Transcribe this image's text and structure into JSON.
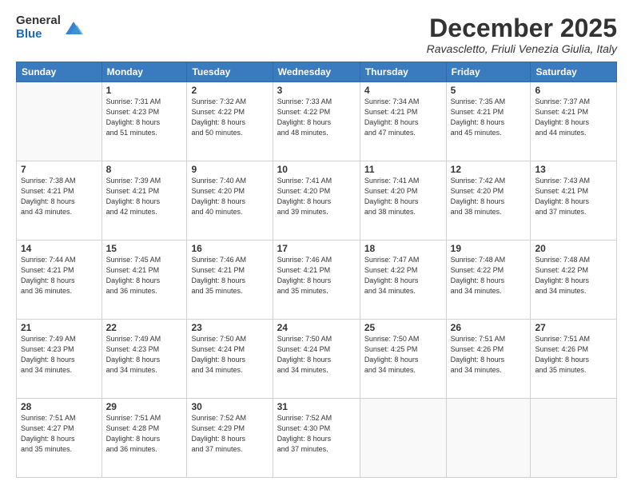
{
  "logo": {
    "general": "General",
    "blue": "Blue"
  },
  "header": {
    "month": "December 2025",
    "location": "Ravascletto, Friuli Venezia Giulia, Italy"
  },
  "weekdays": [
    "Sunday",
    "Monday",
    "Tuesday",
    "Wednesday",
    "Thursday",
    "Friday",
    "Saturday"
  ],
  "weeks": [
    [
      {
        "day": "",
        "info": ""
      },
      {
        "day": "1",
        "info": "Sunrise: 7:31 AM\nSunset: 4:23 PM\nDaylight: 8 hours\nand 51 minutes."
      },
      {
        "day": "2",
        "info": "Sunrise: 7:32 AM\nSunset: 4:22 PM\nDaylight: 8 hours\nand 50 minutes."
      },
      {
        "day": "3",
        "info": "Sunrise: 7:33 AM\nSunset: 4:22 PM\nDaylight: 8 hours\nand 48 minutes."
      },
      {
        "day": "4",
        "info": "Sunrise: 7:34 AM\nSunset: 4:21 PM\nDaylight: 8 hours\nand 47 minutes."
      },
      {
        "day": "5",
        "info": "Sunrise: 7:35 AM\nSunset: 4:21 PM\nDaylight: 8 hours\nand 45 minutes."
      },
      {
        "day": "6",
        "info": "Sunrise: 7:37 AM\nSunset: 4:21 PM\nDaylight: 8 hours\nand 44 minutes."
      }
    ],
    [
      {
        "day": "7",
        "info": "Sunrise: 7:38 AM\nSunset: 4:21 PM\nDaylight: 8 hours\nand 43 minutes."
      },
      {
        "day": "8",
        "info": "Sunrise: 7:39 AM\nSunset: 4:21 PM\nDaylight: 8 hours\nand 42 minutes."
      },
      {
        "day": "9",
        "info": "Sunrise: 7:40 AM\nSunset: 4:20 PM\nDaylight: 8 hours\nand 40 minutes."
      },
      {
        "day": "10",
        "info": "Sunrise: 7:41 AM\nSunset: 4:20 PM\nDaylight: 8 hours\nand 39 minutes."
      },
      {
        "day": "11",
        "info": "Sunrise: 7:41 AM\nSunset: 4:20 PM\nDaylight: 8 hours\nand 38 minutes."
      },
      {
        "day": "12",
        "info": "Sunrise: 7:42 AM\nSunset: 4:20 PM\nDaylight: 8 hours\nand 38 minutes."
      },
      {
        "day": "13",
        "info": "Sunrise: 7:43 AM\nSunset: 4:21 PM\nDaylight: 8 hours\nand 37 minutes."
      }
    ],
    [
      {
        "day": "14",
        "info": "Sunrise: 7:44 AM\nSunset: 4:21 PM\nDaylight: 8 hours\nand 36 minutes."
      },
      {
        "day": "15",
        "info": "Sunrise: 7:45 AM\nSunset: 4:21 PM\nDaylight: 8 hours\nand 36 minutes."
      },
      {
        "day": "16",
        "info": "Sunrise: 7:46 AM\nSunset: 4:21 PM\nDaylight: 8 hours\nand 35 minutes."
      },
      {
        "day": "17",
        "info": "Sunrise: 7:46 AM\nSunset: 4:21 PM\nDaylight: 8 hours\nand 35 minutes."
      },
      {
        "day": "18",
        "info": "Sunrise: 7:47 AM\nSunset: 4:22 PM\nDaylight: 8 hours\nand 34 minutes."
      },
      {
        "day": "19",
        "info": "Sunrise: 7:48 AM\nSunset: 4:22 PM\nDaylight: 8 hours\nand 34 minutes."
      },
      {
        "day": "20",
        "info": "Sunrise: 7:48 AM\nSunset: 4:22 PM\nDaylight: 8 hours\nand 34 minutes."
      }
    ],
    [
      {
        "day": "21",
        "info": "Sunrise: 7:49 AM\nSunset: 4:23 PM\nDaylight: 8 hours\nand 34 minutes."
      },
      {
        "day": "22",
        "info": "Sunrise: 7:49 AM\nSunset: 4:23 PM\nDaylight: 8 hours\nand 34 minutes."
      },
      {
        "day": "23",
        "info": "Sunrise: 7:50 AM\nSunset: 4:24 PM\nDaylight: 8 hours\nand 34 minutes."
      },
      {
        "day": "24",
        "info": "Sunrise: 7:50 AM\nSunset: 4:24 PM\nDaylight: 8 hours\nand 34 minutes."
      },
      {
        "day": "25",
        "info": "Sunrise: 7:50 AM\nSunset: 4:25 PM\nDaylight: 8 hours\nand 34 minutes."
      },
      {
        "day": "26",
        "info": "Sunrise: 7:51 AM\nSunset: 4:26 PM\nDaylight: 8 hours\nand 34 minutes."
      },
      {
        "day": "27",
        "info": "Sunrise: 7:51 AM\nSunset: 4:26 PM\nDaylight: 8 hours\nand 35 minutes."
      }
    ],
    [
      {
        "day": "28",
        "info": "Sunrise: 7:51 AM\nSunset: 4:27 PM\nDaylight: 8 hours\nand 35 minutes."
      },
      {
        "day": "29",
        "info": "Sunrise: 7:51 AM\nSunset: 4:28 PM\nDaylight: 8 hours\nand 36 minutes."
      },
      {
        "day": "30",
        "info": "Sunrise: 7:52 AM\nSunset: 4:29 PM\nDaylight: 8 hours\nand 37 minutes."
      },
      {
        "day": "31",
        "info": "Sunrise: 7:52 AM\nSunset: 4:30 PM\nDaylight: 8 hours\nand 37 minutes."
      },
      {
        "day": "",
        "info": ""
      },
      {
        "day": "",
        "info": ""
      },
      {
        "day": "",
        "info": ""
      }
    ]
  ]
}
